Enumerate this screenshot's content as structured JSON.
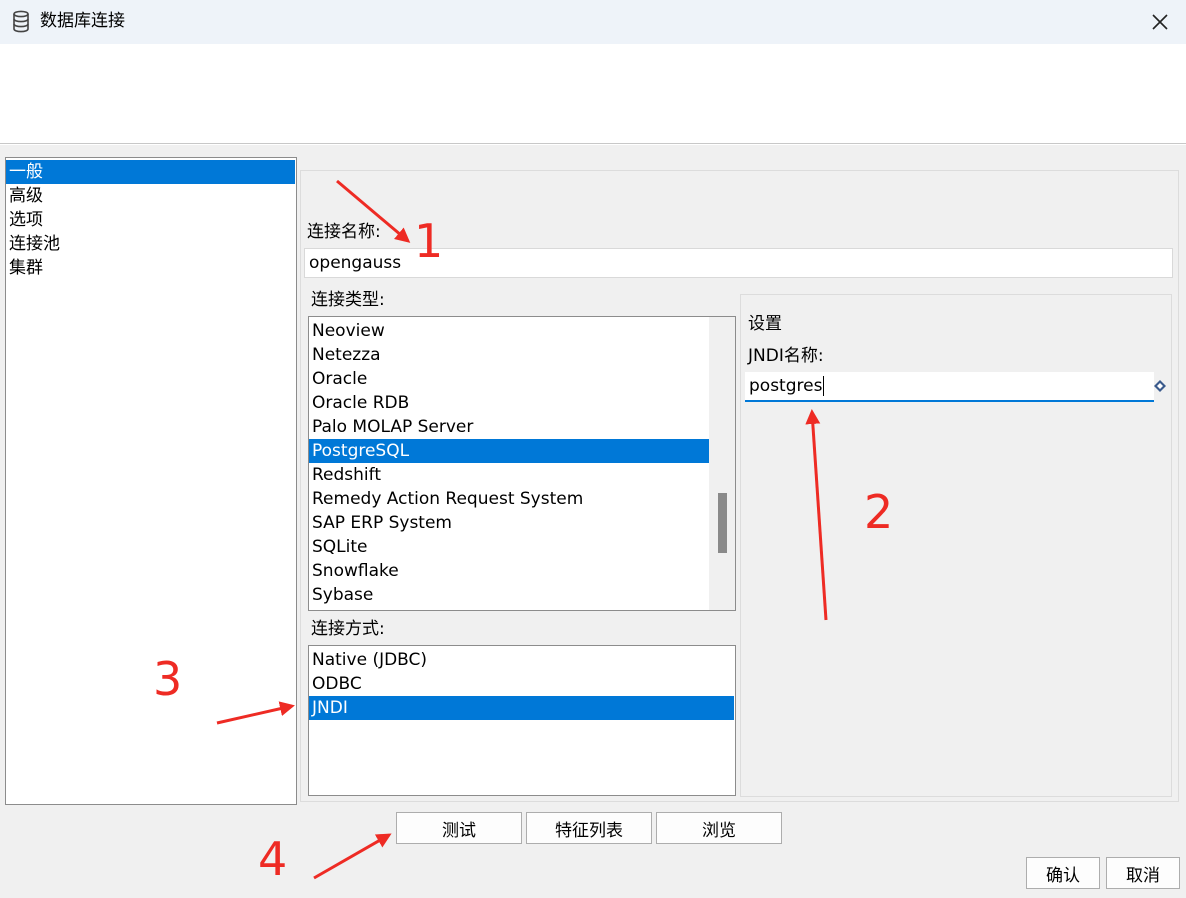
{
  "window": {
    "title": "数据库连接",
    "close_icon": "×"
  },
  "nav": {
    "items": [
      {
        "label": "一般",
        "selected": true
      },
      {
        "label": "高级",
        "selected": false
      },
      {
        "label": "选项",
        "selected": false
      },
      {
        "label": "连接池",
        "selected": false
      },
      {
        "label": "集群",
        "selected": false
      }
    ]
  },
  "form": {
    "connection_name_label": "连接名称:",
    "connection_name_value": "opengauss",
    "connection_type_label": "连接类型:",
    "connection_types": [
      {
        "label": "Neoview",
        "selected": false
      },
      {
        "label": "Netezza",
        "selected": false
      },
      {
        "label": "Oracle",
        "selected": false
      },
      {
        "label": "Oracle RDB",
        "selected": false
      },
      {
        "label": "Palo MOLAP Server",
        "selected": false
      },
      {
        "label": "PostgreSQL",
        "selected": true
      },
      {
        "label": "Redshift",
        "selected": false
      },
      {
        "label": "Remedy Action Request System",
        "selected": false
      },
      {
        "label": "SAP ERP System",
        "selected": false
      },
      {
        "label": "SQLite",
        "selected": false
      },
      {
        "label": "Snowflake",
        "selected": false
      },
      {
        "label": "Sybase",
        "selected": false
      }
    ],
    "connection_method_label": "连接方式:",
    "connection_methods": [
      {
        "label": "Native (JDBC)",
        "selected": false
      },
      {
        "label": "ODBC",
        "selected": false
      },
      {
        "label": "JNDI",
        "selected": true
      }
    ]
  },
  "settings": {
    "title": "设置",
    "jndi_name_label": "JNDI名称:",
    "jndi_name_value": "postgres"
  },
  "buttons": {
    "test": "测试",
    "feature_list": "特征列表",
    "browse": "浏览",
    "ok": "确认",
    "cancel": "取消"
  },
  "annotations": {
    "color": "#ee2b24",
    "labels": [
      "1",
      "2",
      "3",
      "4"
    ]
  },
  "colors": {
    "selection": "#0078d7",
    "titlebar": "#eef3f9",
    "dialog_bg": "#f0f0f0"
  }
}
